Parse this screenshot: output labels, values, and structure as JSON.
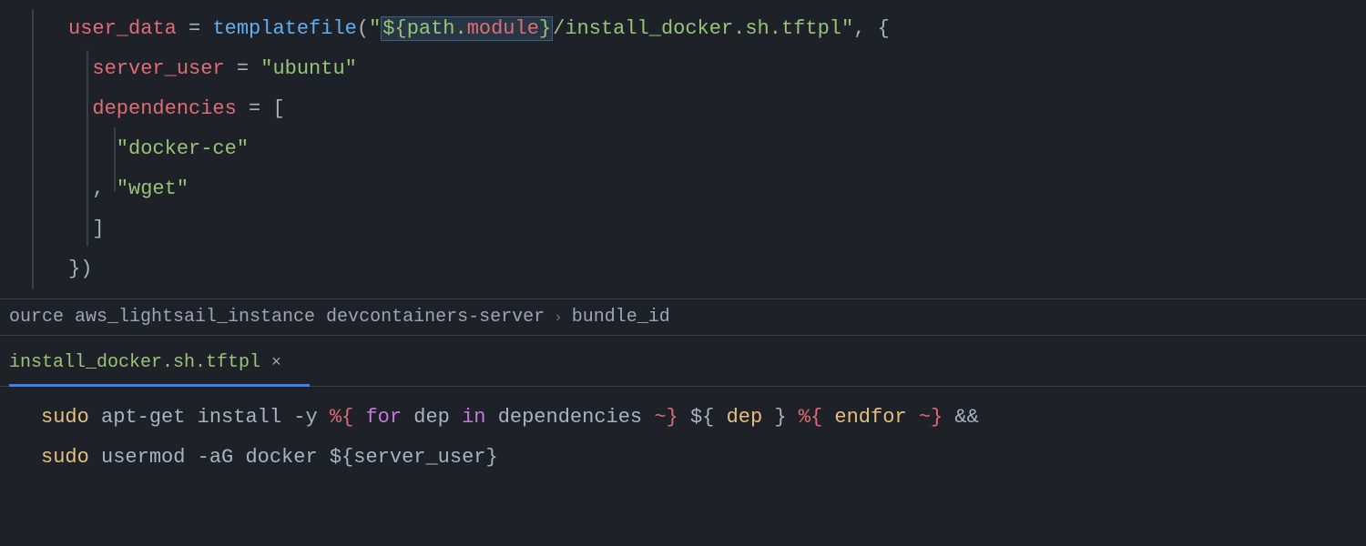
{
  "top": {
    "l1": {
      "ident": "user_data",
      "eq": " = ",
      "fn": "templatefile",
      "open": "(",
      "q1": "\"",
      "interp_open": "${",
      "interp_path": "path",
      "interp_dot": ".",
      "interp_module": "module",
      "interp_close": "}",
      "pathrest": "/install_docker.sh.tftpl",
      "q2": "\"",
      "after": ", {"
    },
    "l2": {
      "key": "server_user",
      "eq": " = ",
      "val": "\"ubuntu\""
    },
    "l3": {
      "key": "dependencies",
      "eq": " = [",
      "end": ""
    },
    "l4": {
      "val": "  \"docker-ce\""
    },
    "l5": {
      "pre": ", ",
      "val": "\"wget\""
    },
    "l6": {
      "txt": "]"
    },
    "l7": {
      "txt": "})"
    }
  },
  "breadcrumb": {
    "seg1": "ource aws_lightsail_instance devcontainers-server",
    "seg2": "bundle_id"
  },
  "tab": {
    "name": "install_docker.sh.tftpl",
    "close": "×"
  },
  "bottom": {
    "l1": {
      "p1": "sudo",
      "p2": " apt-get install -y ",
      "t1": "%{",
      "t2": " for ",
      "t3": "dep",
      "t4": " in ",
      "t5": "dependencies ",
      "t6": "~}",
      "t7": " ${ ",
      "t8": "dep",
      "t9": " } ",
      "t10": "%{",
      "t11": " endfor ",
      "t12": "~}",
      "t13": " &&"
    },
    "l2": {
      "p1": "sudo",
      "p2": " usermod -aG docker ",
      "t1": "${",
      "t2": "server_user",
      "t3": "}"
    }
  }
}
